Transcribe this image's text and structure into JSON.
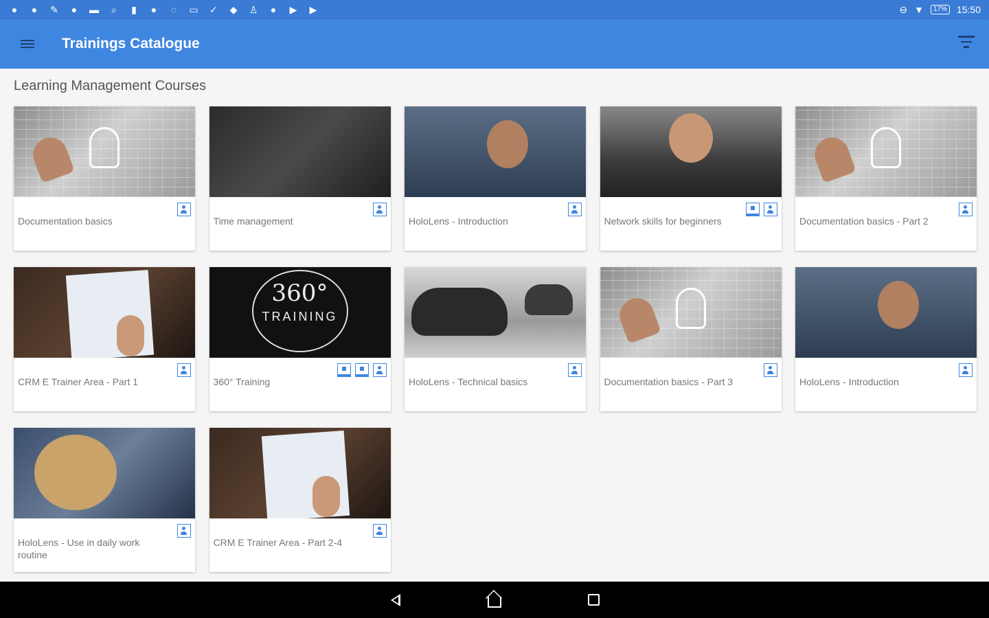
{
  "status_bar": {
    "icons": [
      "notification-icon",
      "notification-icon",
      "wrench-icon",
      "notification-icon",
      "message-icon",
      "search-icon",
      "battery-icon",
      "notification-icon",
      "bulb-icon",
      "image-icon",
      "check-icon",
      "chat-icon",
      "person-icon",
      "notification-icon",
      "play-icon",
      "play-icon"
    ],
    "battery": "17%",
    "time": "15:50"
  },
  "app_bar": {
    "title": "Trainings Catalogue"
  },
  "section": {
    "title": "Learning Management Courses"
  },
  "courses": [
    {
      "title": "Documentation basics",
      "thumb": "sketch",
      "icons": [
        "user-icon"
      ]
    },
    {
      "title": "Time management",
      "thumb": "office",
      "icons": [
        "user-icon"
      ]
    },
    {
      "title": "HoloLens - Introduction",
      "thumb": "person",
      "icons": [
        "user-icon"
      ]
    },
    {
      "title": "Network skills for beginners",
      "thumb": "dark-person",
      "icons": [
        "monitor-icon",
        "user-icon"
      ]
    },
    {
      "title": "Documentation basics - Part 2",
      "thumb": "sketch",
      "icons": [
        "user-icon"
      ]
    },
    {
      "title": "CRM E Trainer Area - Part 1",
      "thumb": "tablet",
      "icons": [
        "user-icon"
      ]
    },
    {
      "title": "360° Training",
      "thumb": "360",
      "icons": [
        "monitor-icon",
        "monitor-icon",
        "user-icon"
      ]
    },
    {
      "title": "HoloLens - Technical basics",
      "thumb": "headset",
      "icons": [
        "user-icon"
      ]
    },
    {
      "title": "Documentation basics - Part 3",
      "thumb": "sketch",
      "icons": [
        "user-icon"
      ]
    },
    {
      "title": "HoloLens - Introduction",
      "thumb": "person",
      "icons": [
        "user-icon"
      ]
    },
    {
      "title": "HoloLens - Use in daily work routine",
      "thumb": "blonde",
      "icons": [
        "user-icon"
      ]
    },
    {
      "title": "CRM E Trainer Area - Part 2-4",
      "thumb": "tablet",
      "icons": [
        "user-icon"
      ]
    }
  ],
  "thumb_text_360": {
    "line1": "360°",
    "line2": "TRAINING"
  },
  "colors": {
    "status_bar": "#3a7bd5",
    "app_bar": "#3f86e0",
    "accent": "#3f86e0"
  }
}
